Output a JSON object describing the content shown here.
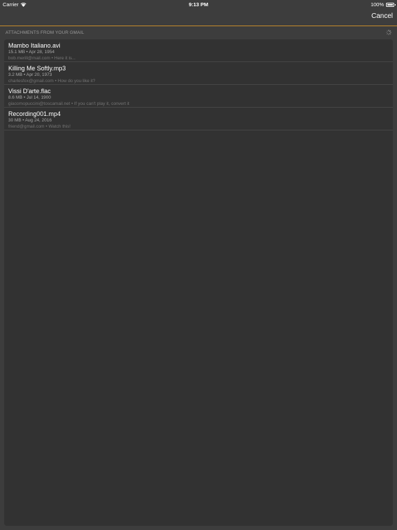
{
  "status_bar": {
    "carrier": "Carrier",
    "time": "9:13 PM",
    "battery": "100%"
  },
  "nav_bar": {
    "cancel_label": "Cancel",
    "accent_color": "#c58a2b"
  },
  "section": {
    "title": "ATTACHMENTS FROM YOUR GMAIL"
  },
  "attachments": [
    {
      "name": "Mambo Italiano.avi",
      "meta": "15.1 MB • Apr 28, 1954",
      "detail": "bob.merill@mail.com • Here it is..."
    },
    {
      "name": "Killing Me Softly.mp3",
      "meta": "3.2 MB • Apr 20, 1973",
      "detail": "charlesfox@gmail.com • How do you like it?"
    },
    {
      "name": "Vissi D'arte.flac",
      "meta": "8.6 MB • Jul 14, 1900",
      "detail": "giacomopuccini@toscamail.net • If you can't play it, convert it"
    },
    {
      "name": "Recording001.mp4",
      "meta": "30 MB • Aug 24, 2016",
      "detail": "friend@gmail.com • Watch this!"
    }
  ]
}
